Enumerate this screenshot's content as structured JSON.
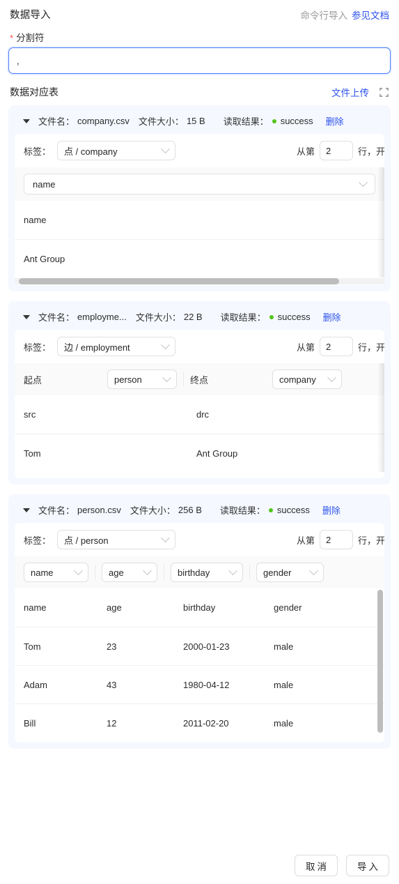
{
  "header": {
    "title": "数据导入",
    "cli_text": "命令行导入",
    "doc_link": "参见文档"
  },
  "delimiter_field": {
    "required_mark": "*",
    "label": "分割符",
    "value": ",",
    "placeholder": ""
  },
  "mapping_section": {
    "title": "数据对应表",
    "upload_link": "文件上传",
    "expand_icon": "fullscreen-icon"
  },
  "labels": {
    "file_name": "文件名：",
    "file_size": "文件大小：",
    "read_result": "读取结果：",
    "delete": "删除",
    "tag": "标签：",
    "from_line_prefix": "从第",
    "from_line_suffix": "行，开始",
    "src": "起点",
    "dst": "终点"
  },
  "status_color": "#52c41a",
  "link_color": "#2f54eb",
  "files": [
    {
      "name": "company.csv",
      "name_display": "company.csv",
      "size": "15 B",
      "status": "success",
      "tag": "点 / company",
      "start_line": "2",
      "kind": "vertex",
      "column_selectors": [
        "name"
      ],
      "table_rows": [
        [
          "name"
        ],
        [
          "Ant Group"
        ]
      ],
      "hscroll": true,
      "vscroll": false
    },
    {
      "name": "employment.csv",
      "name_display": "employme...",
      "size": "22 B",
      "status": "success",
      "tag": "边 / employment",
      "start_line": "2",
      "kind": "edge",
      "src_select": "person",
      "dst_select": "company",
      "table_rows": [
        [
          "src",
          "drc"
        ],
        [
          "Tom",
          "Ant Group"
        ]
      ],
      "hscroll": false,
      "vscroll": false
    },
    {
      "name": "person.csv",
      "name_display": "person.csv",
      "size": "256 B",
      "status": "success",
      "tag": "点 / person",
      "start_line": "2",
      "kind": "vertex",
      "column_selectors": [
        "name",
        "age",
        "birthday",
        "gender"
      ],
      "table_rows": [
        [
          "name",
          "age",
          "birthday",
          "gender"
        ],
        [
          "Tom",
          "23",
          "2000-01-23",
          "male"
        ],
        [
          "Adam",
          "43",
          "1980-04-12",
          "male"
        ],
        [
          "Bill",
          "12",
          "2011-02-20",
          "male"
        ]
      ],
      "hscroll": false,
      "vscroll": true
    }
  ],
  "footer": {
    "cancel": "取消",
    "import": "导入"
  }
}
